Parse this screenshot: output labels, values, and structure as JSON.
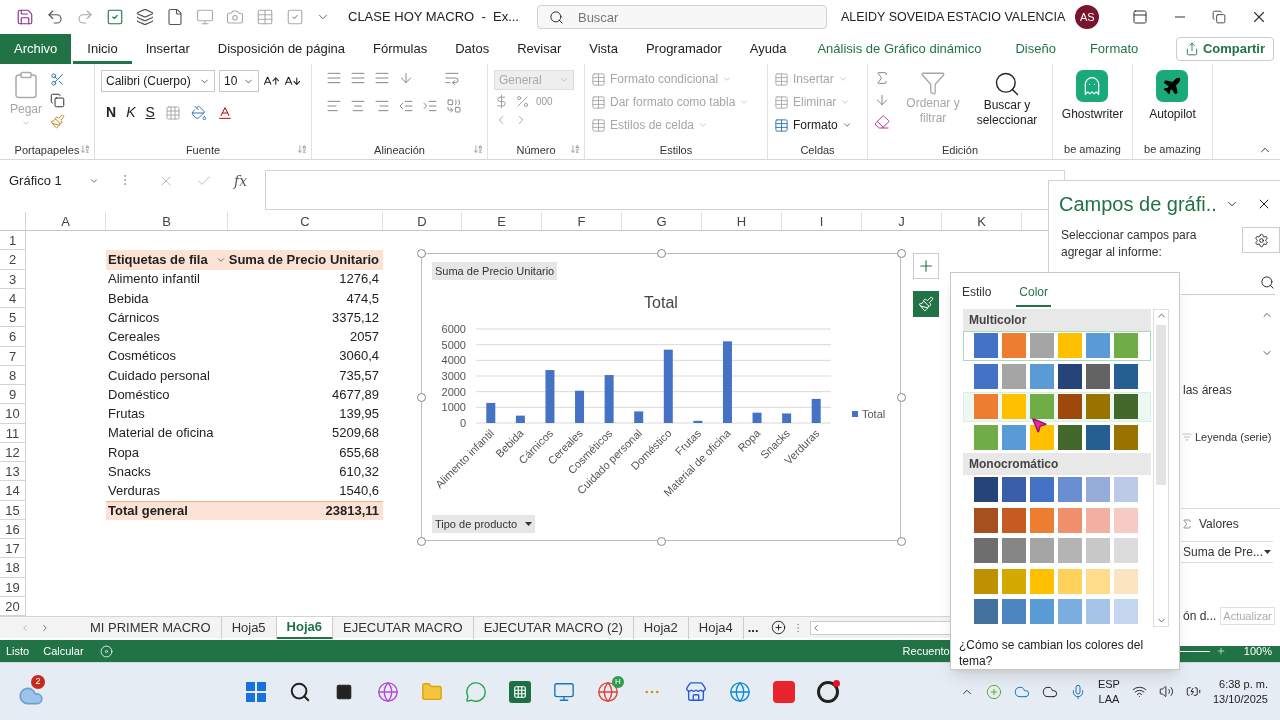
{
  "title_bar": {
    "title": "CLASE HOY MACRO  -  Ex...",
    "search_placeholder": "Buscar",
    "user": "ALEIDY SOVEIDA ESTACIO VALENCIA",
    "avatar": "AS"
  },
  "menu_tabs": [
    {
      "label": "Archivo",
      "kind": "file",
      "selected": false
    },
    {
      "label": "Inicio",
      "kind": "normal",
      "selected": true
    },
    {
      "label": "Insertar",
      "kind": "normal",
      "selected": false
    },
    {
      "label": "Disposición de página",
      "kind": "normal",
      "selected": false
    },
    {
      "label": "Fórmulas",
      "kind": "normal",
      "selected": false
    },
    {
      "label": "Datos",
      "kind": "normal",
      "selected": false
    },
    {
      "label": "Revisar",
      "kind": "normal",
      "selected": false
    },
    {
      "label": "Vista",
      "kind": "normal",
      "selected": false
    },
    {
      "label": "Programador",
      "kind": "normal",
      "selected": false
    },
    {
      "label": "Ayuda",
      "kind": "normal",
      "selected": false
    },
    {
      "label": "Análisis de Gráfico dinámico",
      "kind": "context",
      "selected": false
    },
    {
      "label": "Diseño",
      "kind": "context",
      "selected": false
    },
    {
      "label": "Formato",
      "kind": "context",
      "selected": false
    }
  ],
  "share_button": "Compartir",
  "ribbon": {
    "clipboard": {
      "label": "Portapapeles",
      "paste": "Pegar"
    },
    "font": {
      "label": "Fuente",
      "family": "Calibri (Cuerpo)",
      "size": "10",
      "bold": "N",
      "italic": "K",
      "underline": "S"
    },
    "alignment": {
      "label": "Alineación"
    },
    "number": {
      "label": "Número",
      "format": "General",
      "thousands": "000"
    },
    "styles": {
      "label": "Estilos",
      "items": [
        {
          "label": "Formato condicional",
          "disabled": true
        },
        {
          "label": "Dar formato como tabla",
          "disabled": true
        },
        {
          "label": "Estilos de celda",
          "disabled": true
        }
      ]
    },
    "cells": {
      "label": "Celdas",
      "items": [
        {
          "label": "Insertar",
          "disabled": true
        },
        {
          "label": "Eliminar",
          "disabled": true
        },
        {
          "label": "Formato",
          "disabled": false
        }
      ]
    },
    "editing": {
      "label": "Edición",
      "sort": "Ordenar y filtrar",
      "find": "Buscar y seleccionar"
    },
    "addins": [
      {
        "name": "Ghostwriter",
        "caption": "be amazing",
        "kind": "ghost"
      },
      {
        "name": "Autopilot",
        "caption": "be amazing",
        "kind": "plane"
      }
    ]
  },
  "formula_bar": {
    "name_box": "Gráfico 1",
    "function_label": "fx"
  },
  "columns": [
    "A",
    "B",
    "C",
    "D",
    "E",
    "F",
    "G",
    "H",
    "I",
    "J",
    "K"
  ],
  "row_numbers": [
    "1",
    "2",
    "3",
    "4",
    "5",
    "6",
    "7",
    "8",
    "9",
    "10",
    "11",
    "12",
    "13",
    "14",
    "15",
    "16",
    "17",
    "18",
    "19",
    "20"
  ],
  "pivot": {
    "header": [
      "Etiquetas de fila",
      "Suma de Precio Unitario"
    ],
    "rows": [
      {
        "label": "Alimento infantil",
        "value": "1276,4"
      },
      {
        "label": "Bebida",
        "value": "474,5"
      },
      {
        "label": "Cárnicos",
        "value": "3375,12"
      },
      {
        "label": "Cereales",
        "value": "2057"
      },
      {
        "label": "Cosméticos",
        "value": "3060,4"
      },
      {
        "label": "Cuidado personal",
        "value": "735,57"
      },
      {
        "label": "Doméstico",
        "value": "4677,89"
      },
      {
        "label": "Frutas",
        "value": "139,95"
      },
      {
        "label": "Material de oficina",
        "value": "5209,68"
      },
      {
        "label": "Ropa",
        "value": "655,68"
      },
      {
        "label": "Snacks",
        "value": "610,32"
      },
      {
        "label": "Verduras",
        "value": "1540,6"
      }
    ],
    "total": {
      "label": "Total general",
      "value": "23813,11"
    }
  },
  "chart": {
    "value_button": "Suma de Precio Unitario",
    "axis_button": "Tipo de producto",
    "chart_data": {
      "type": "bar",
      "title": "Total",
      "categories": [
        "Alimento infantil",
        "Bebida",
        "Cárnicos",
        "Cereales",
        "Cosméticos",
        "Cuidado personal",
        "Doméstico",
        "Frutas",
        "Material de oficina",
        "Ropa",
        "Snacks",
        "Verduras"
      ],
      "series": [
        {
          "name": "Total",
          "color": "#4472c4",
          "values": [
            1280,
            470,
            3380,
            2060,
            3060,
            740,
            4680,
            140,
            5210,
            660,
            610,
            1540
          ]
        }
      ],
      "grid": true,
      "ylim": [
        0,
        6000
      ],
      "yticks": [
        0,
        1000,
        2000,
        3000,
        4000,
        5000,
        6000
      ]
    }
  },
  "field_pane": {
    "title": "Campos de gráfi..",
    "instruction": "Seleccionar campos para agregar al informe:",
    "areas_text": "las áreas",
    "legend_area": "Leyenda (serie)",
    "values_area": "Valores",
    "value_field": "Suma de Pre...",
    "defer_text": "ón d...",
    "update_button": "Actualizar"
  },
  "color_popup": {
    "tabs": [
      {
        "label": "Estilo",
        "selected": false
      },
      {
        "label": "Color",
        "selected": true
      }
    ],
    "groups": [
      {
        "title": "Multicolor",
        "palettes": [
          {
            "selected": true,
            "hovered": false,
            "swatches": [
              {
                "color": "#4472c4"
              },
              {
                "color": "#ed7d31"
              },
              {
                "color": "#a5a5a5"
              },
              {
                "color": "#ffc000"
              },
              {
                "color": "#5b9bd5"
              },
              {
                "color": "#70ad47"
              }
            ]
          },
          {
            "selected": false,
            "hovered": false,
            "swatches": [
              {
                "color": "#4472c4"
              },
              {
                "color": "#a5a5a5"
              },
              {
                "color": "#5b9bd5"
              },
              {
                "color": "#264478"
              },
              {
                "color": "#636363"
              },
              {
                "color": "#255e91"
              }
            ]
          },
          {
            "selected": false,
            "hovered": true,
            "swatches": [
              {
                "color": "#ed7d31"
              },
              {
                "color": "#ffc000"
              },
              {
                "color": "#70ad47"
              },
              {
                "color": "#9e480e"
              },
              {
                "color": "#997300"
              },
              {
                "color": "#43682b"
              }
            ]
          },
          {
            "selected": false,
            "hovered": false,
            "swatches": [
              {
                "color": "#70ad47"
              },
              {
                "color": "#5b9bd5"
              },
              {
                "color": "#ffc000"
              },
              {
                "color": "#43682b"
              },
              {
                "color": "#255e91"
              },
              {
                "color": "#997300"
              }
            ]
          }
        ]
      },
      {
        "title": "Monocromático",
        "palettes": [
          {
            "selected": false,
            "hovered": false,
            "swatches": [
              {
                "color": "#264478"
              },
              {
                "color": "#3a5ea8"
              },
              {
                "color": "#4472c4"
              },
              {
                "color": "#6a8ed2"
              },
              {
                "color": "#96acd8"
              },
              {
                "color": "#bccae8"
              }
            ]
          },
          {
            "selected": false,
            "hovered": false,
            "swatches": [
              {
                "color": "#a5501f"
              },
              {
                "color": "#c55a22"
              },
              {
                "color": "#ed7d31"
              },
              {
                "color": "#ef8f6b"
              },
              {
                "color": "#f2b0a3"
              },
              {
                "color": "#f6cbc4"
              }
            ]
          },
          {
            "selected": false,
            "hovered": false,
            "swatches": [
              {
                "color": "#6e6e6e"
              },
              {
                "color": "#868686"
              },
              {
                "color": "#a5a5a5"
              },
              {
                "color": "#b4b4b4"
              },
              {
                "color": "#c8c8c8"
              },
              {
                "color": "#dcdcdc"
              }
            ]
          },
          {
            "selected": false,
            "hovered": false,
            "swatches": [
              {
                "color": "#bf9000"
              },
              {
                "color": "#d4a900"
              },
              {
                "color": "#ffc000"
              },
              {
                "color": "#ffd05a"
              },
              {
                "color": "#ffdb8c"
              },
              {
                "color": "#fde4c0"
              }
            ]
          },
          {
            "selected": false,
            "hovered": false,
            "swatches": [
              {
                "color": "#41719c"
              },
              {
                "color": "#4d85c0"
              },
              {
                "color": "#5b9bd5"
              },
              {
                "color": "#7caddf"
              },
              {
                "color": "#a5c4e8"
              },
              {
                "color": "#c5d7ef"
              }
            ]
          }
        ]
      }
    ],
    "help_link": "¿Cómo se cambian los colores del tema?"
  },
  "sheet_tabs": [
    {
      "label": "MI PRIMER MACRO",
      "selected": false
    },
    {
      "label": "Hoja5",
      "selected": false
    },
    {
      "label": "Hoja6",
      "selected": true
    },
    {
      "label": "EJECUTAR MACRO",
      "selected": false
    },
    {
      "label": "EJECUTAR MACRO (2)",
      "selected": false
    },
    {
      "label": "Hoja2",
      "selected": false
    },
    {
      "label": "Hoja4",
      "selected": false
    }
  ],
  "sheet_more": "...",
  "status_bar": {
    "ready": "Listo",
    "calculate": "Calcular",
    "count": "Recuento",
    "zoom": "100%"
  },
  "taskbar": {
    "weather_badge": "2",
    "browser_badge": "H",
    "language": "ESP",
    "layout": "LAA",
    "time": "6:38 p. m.",
    "date": "13/10/2025"
  }
}
